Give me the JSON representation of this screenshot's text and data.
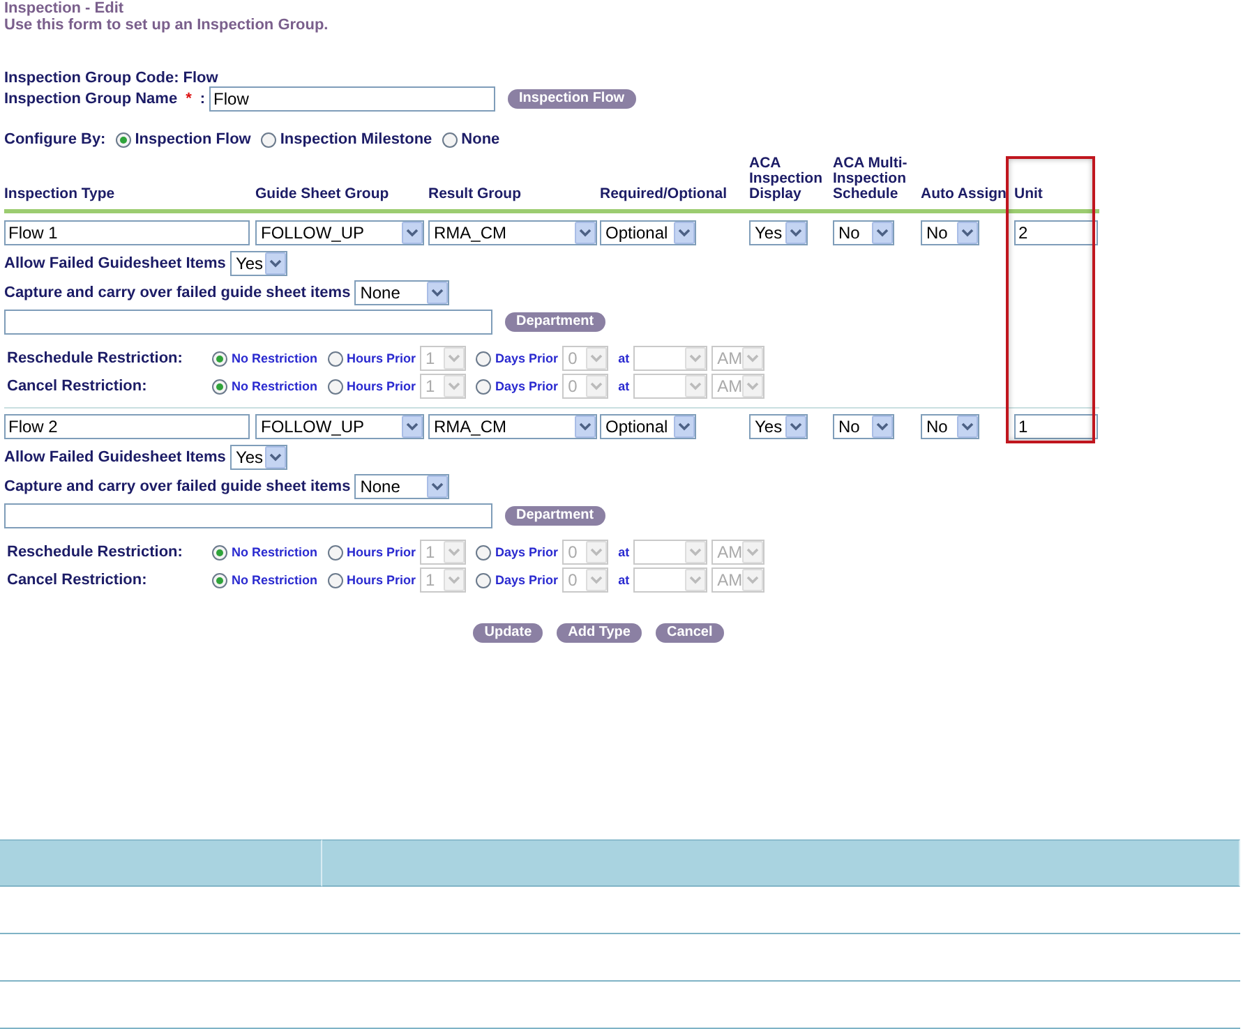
{
  "page": {
    "title": "Inspection - Edit",
    "subtitle": "Use this form to set up an Inspection Group."
  },
  "group": {
    "code_label": "Inspection Group Code:",
    "code": "Flow",
    "name_label": "Inspection Group Name",
    "required_mark": "*",
    "name_colon": ":",
    "name": "Flow",
    "flow_button": "Inspection Flow"
  },
  "configure": {
    "label": "Configure By:",
    "options": [
      {
        "label": "Inspection Flow",
        "selected": true
      },
      {
        "label": "Inspection Milestone",
        "selected": false
      },
      {
        "label": "None",
        "selected": false
      }
    ]
  },
  "columns": [
    {
      "label": "Inspection Type",
      "highlighted": false
    },
    {
      "label": "Guide Sheet Group",
      "highlighted": false
    },
    {
      "label": "Result Group",
      "highlighted": false
    },
    {
      "label": "Required/Optional",
      "highlighted": false
    },
    {
      "label": "ACA Inspection Display",
      "highlighted": false
    },
    {
      "label": "ACA Multi-Inspection Schedule",
      "highlighted": false
    },
    {
      "label": "Auto Assign",
      "highlighted": false
    },
    {
      "label": "Unit",
      "highlighted": true
    }
  ],
  "types": [
    {
      "name": "Flow 1",
      "guide_sheet_group": "FOLLOW_UP",
      "result_group": "RMA_CM",
      "required": "Optional",
      "aca_display": "Yes",
      "aca_multi": "No",
      "auto_assign": "No",
      "unit": "2",
      "allow_label": "Allow Failed Guidesheet Items",
      "allow_value": "Yes",
      "capture_label": "Capture and carry over failed guide sheet items",
      "capture_value": "None",
      "department_button": "Department",
      "restrictions": [
        {
          "label": "Reschedule Restriction:",
          "options": [
            {
              "label": "No Restriction",
              "selected": true
            },
            {
              "label": "Hours Prior",
              "selected": false,
              "value": "1"
            },
            {
              "label": "Days Prior",
              "selected": false,
              "value": "0"
            }
          ],
          "at": "at",
          "ampm": "AM"
        },
        {
          "label": "Cancel Restriction:",
          "options": [
            {
              "label": "No Restriction",
              "selected": true
            },
            {
              "label": "Hours Prior",
              "selected": false,
              "value": "1"
            },
            {
              "label": "Days Prior",
              "selected": false,
              "value": "0"
            }
          ],
          "at": "at",
          "ampm": "AM"
        }
      ]
    },
    {
      "name": "Flow 2",
      "guide_sheet_group": "FOLLOW_UP",
      "result_group": "RMA_CM",
      "required": "Optional",
      "aca_display": "Yes",
      "aca_multi": "No",
      "auto_assign": "No",
      "unit": "1",
      "allow_label": "Allow Failed Guidesheet Items",
      "allow_value": "Yes",
      "capture_label": "Capture and carry over failed guide sheet items",
      "capture_value": "None",
      "department_button": "Department",
      "restrictions": [
        {
          "label": "Reschedule Restriction:",
          "options": [
            {
              "label": "No Restriction",
              "selected": true
            },
            {
              "label": "Hours Prior",
              "selected": false,
              "value": "1"
            },
            {
              "label": "Days Prior",
              "selected": false,
              "value": "0"
            }
          ],
          "at": "at",
          "ampm": "AM"
        },
        {
          "label": "Cancel Restriction:",
          "options": [
            {
              "label": "No Restriction",
              "selected": true
            },
            {
              "label": "Hours Prior",
              "selected": false,
              "value": "1"
            },
            {
              "label": "Days Prior",
              "selected": false,
              "value": "0"
            }
          ],
          "at": "at",
          "ampm": "AM"
        }
      ]
    }
  ],
  "actions": [
    "Update",
    "Add Type",
    "Cancel"
  ]
}
